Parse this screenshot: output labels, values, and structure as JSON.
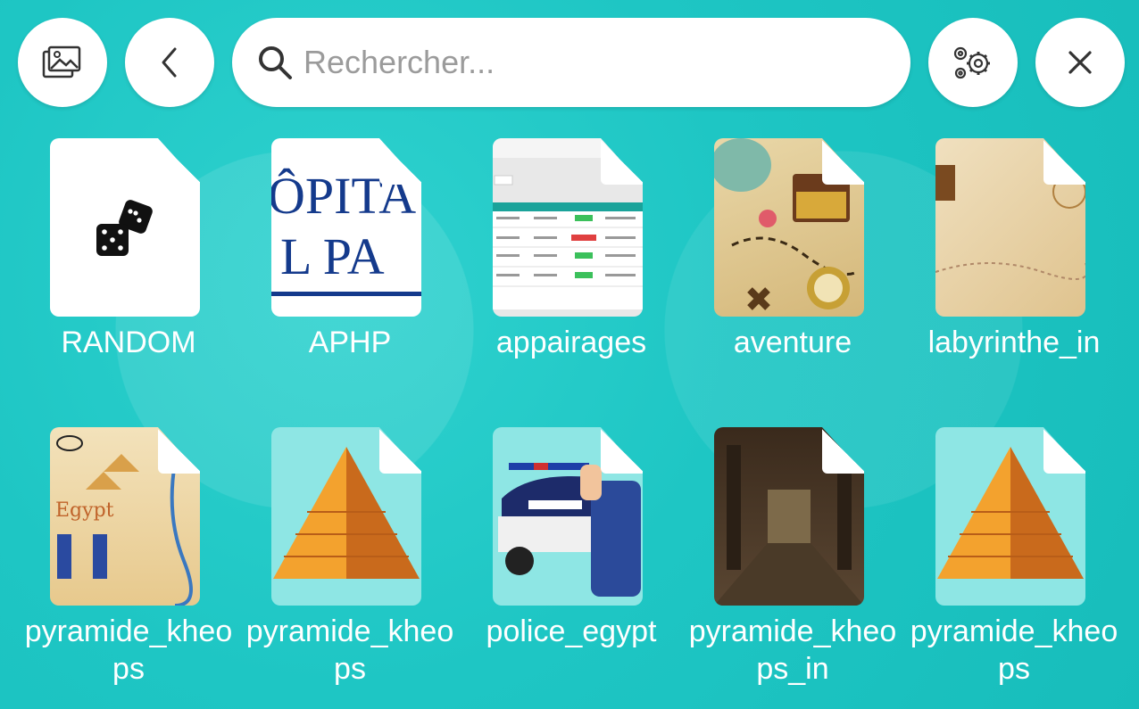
{
  "toolbar": {
    "gallery_icon": "gallery-icon",
    "back_icon": "chevron-left-icon",
    "settings_icon": "gears-icon",
    "close_icon": "close-icon"
  },
  "search": {
    "placeholder": "Rechercher..."
  },
  "grid": {
    "items": [
      {
        "label": "RANDOM",
        "thumb": "dice"
      },
      {
        "label": "APHP",
        "thumb": "aphp-logo"
      },
      {
        "label": "appairages",
        "thumb": "table-screenshot"
      },
      {
        "label": "aventure",
        "thumb": "treasure-map"
      },
      {
        "label": "labyrinthe_in",
        "thumb": "old-map"
      },
      {
        "label": "pyramide_kheops",
        "thumb": "egypt-map"
      },
      {
        "label": "pyramide_kheops",
        "thumb": "pyramid"
      },
      {
        "label": "police_egypt",
        "thumb": "police"
      },
      {
        "label": "pyramide_kheops_in",
        "thumb": "tomb"
      },
      {
        "label": "pyramide_kheops",
        "thumb": "pyramid"
      }
    ]
  },
  "colors": {
    "background": "#1ec6c4",
    "button": "#ffffff"
  }
}
